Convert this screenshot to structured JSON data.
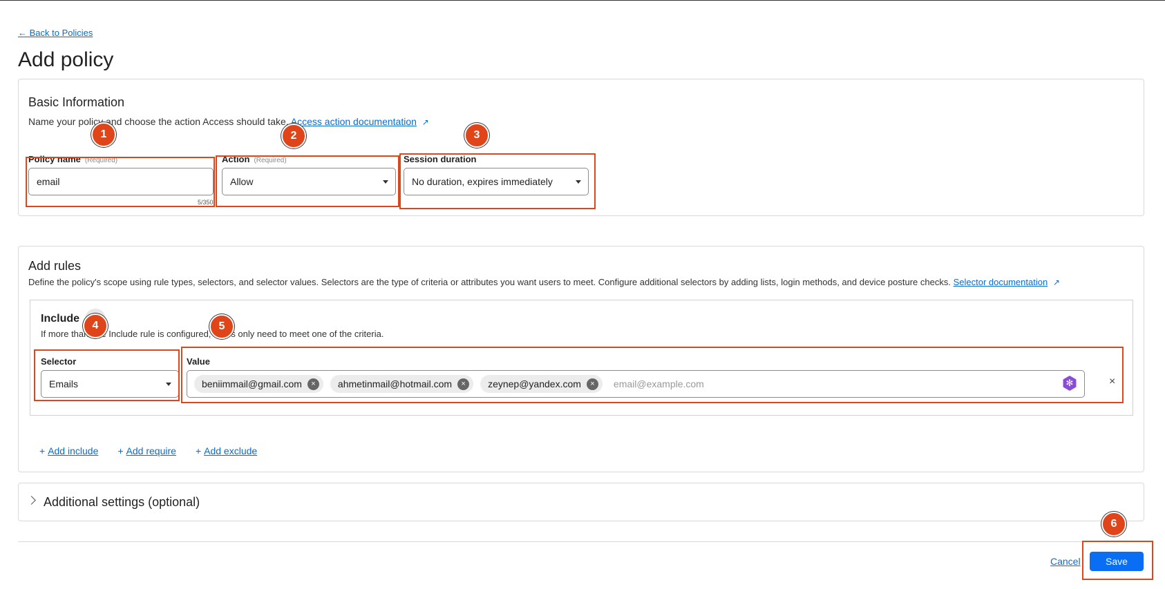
{
  "nav": {
    "back_label": "← Back to Policies"
  },
  "page": {
    "title": "Add policy"
  },
  "basic": {
    "title": "Basic Information",
    "desc_lead": "Name your policy and choose the action Access should take.",
    "desc_link": "Access action documentation",
    "policy_name": {
      "label": "Policy name",
      "required": "(Required)",
      "value": "email",
      "counter": "5/350"
    },
    "action": {
      "label": "Action",
      "required": "(Required)",
      "value": "Allow"
    },
    "session": {
      "label": "Session duration",
      "value": "No duration, expires immediately"
    }
  },
  "rules": {
    "title": "Add rules",
    "desc_lead": "Define the policy's scope using rule types, selectors, and selector values. Selectors are the type of criteria or attributes you want users to meet. Configure additional selectors by adding lists, login methods, and device posture checks.",
    "desc_link": "Selector documentation",
    "include": {
      "title": "Include",
      "desc": "If more than one Include rule is configured, users only need to meet one of the criteria.",
      "selector_label": "Selector",
      "selector_value": "Emails",
      "value_label": "Value",
      "chips": [
        "beniimmail@gmail.com",
        "ahmetinmail@hotmail.com",
        "zeynep@yandex.com"
      ],
      "placeholder": "email@example.com"
    },
    "add_include": "Add include",
    "add_require": "Add require",
    "add_exclude": "Add exclude"
  },
  "additional": {
    "title": "Additional settings (optional)"
  },
  "footer": {
    "cancel": "Cancel",
    "save": "Save"
  },
  "annotations": [
    "1",
    "2",
    "3",
    "4",
    "5",
    "6"
  ],
  "colors": {
    "accent": "#0a6ef5",
    "link": "#0b6bcb",
    "highlight": "#d9481c",
    "badge": "#e0451a",
    "ai_gem": "#8a4bd8"
  },
  "icons": {
    "external": "external-link-icon",
    "remove_chip": "close-icon",
    "caret": "caret-down-icon",
    "ai": "ai-gem-icon",
    "remove_rule": "close-icon",
    "expand": "chevron-right-icon"
  }
}
